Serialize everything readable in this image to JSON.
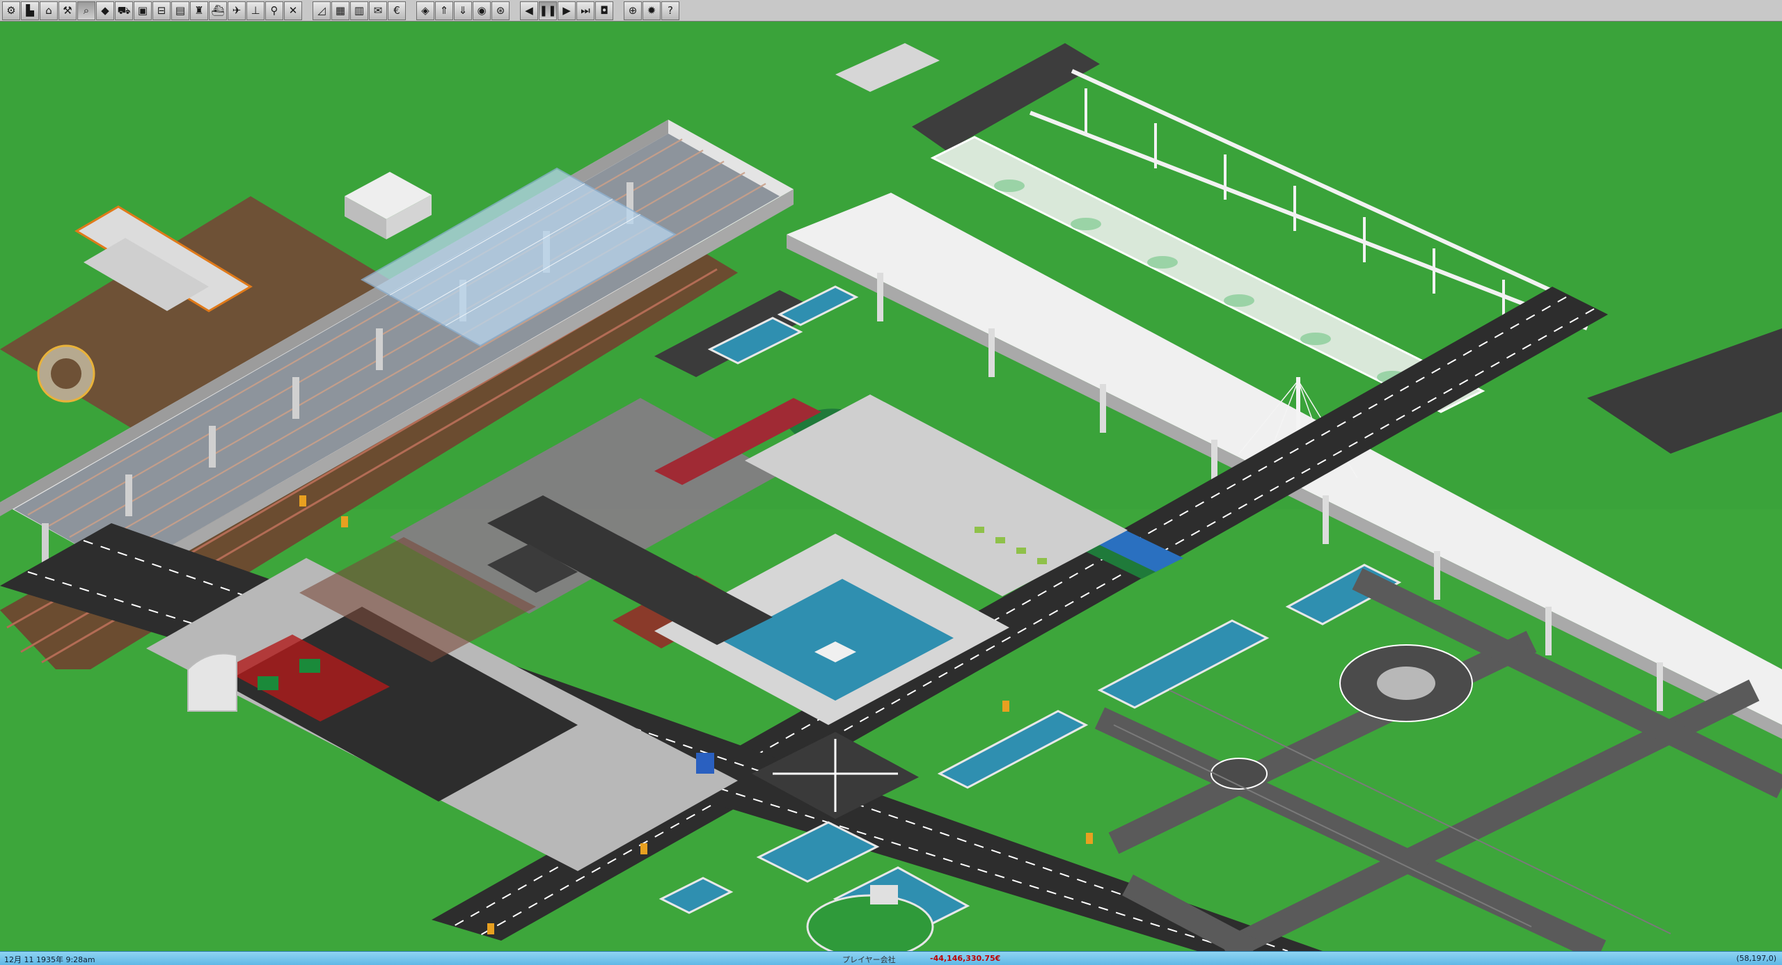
{
  "toolbar": {
    "groups": [
      [
        {
          "name": "settings-icon",
          "glyph": "⚙"
        },
        {
          "name": "factory-icon",
          "glyph": "▙"
        },
        {
          "name": "depot-icon",
          "glyph": "⌂"
        },
        {
          "name": "hammer-icon",
          "glyph": "⚒"
        },
        {
          "name": "magnifier-icon",
          "glyph": "⌕",
          "active": true
        },
        {
          "name": "terrain-icon",
          "glyph": "◆"
        },
        {
          "name": "road-vehicle-icon",
          "glyph": "⛟"
        },
        {
          "name": "bus-icon",
          "glyph": "▣"
        },
        {
          "name": "truck-icon",
          "glyph": "⊟"
        },
        {
          "name": "train-icon",
          "glyph": "▤"
        },
        {
          "name": "tram-icon",
          "glyph": "♜"
        },
        {
          "name": "ship-icon",
          "glyph": "⛴"
        },
        {
          "name": "airplane-icon",
          "glyph": "✈"
        },
        {
          "name": "crane-icon",
          "glyph": "⊥"
        },
        {
          "name": "tools-icon",
          "glyph": "⚲"
        },
        {
          "name": "remove-icon",
          "glyph": "✕"
        }
      ],
      [
        {
          "name": "slope-icon",
          "glyph": "◿"
        },
        {
          "name": "list-icon",
          "glyph": "▦"
        },
        {
          "name": "finance-icon",
          "glyph": "▥"
        },
        {
          "name": "mail-icon",
          "glyph": "✉"
        },
        {
          "name": "euro-icon",
          "glyph": "€"
        }
      ],
      [
        {
          "name": "layer-icon",
          "glyph": "◈"
        },
        {
          "name": "layer-up-icon",
          "glyph": "⇑"
        },
        {
          "name": "layer-down-icon",
          "glyph": "⇓"
        },
        {
          "name": "screenshot-icon",
          "glyph": "◉"
        },
        {
          "name": "network-icon",
          "glyph": "⊛"
        }
      ],
      [
        {
          "name": "step-back-icon",
          "glyph": "◀"
        },
        {
          "name": "pause-icon",
          "glyph": "❚❚",
          "active": true
        },
        {
          "name": "play-icon",
          "glyph": "▶"
        },
        {
          "name": "fast-forward-icon",
          "glyph": "⏭"
        },
        {
          "name": "camera-icon",
          "glyph": "◘"
        }
      ],
      [
        {
          "name": "globe-icon",
          "glyph": "⊕"
        },
        {
          "name": "gear-icon",
          "glyph": "✹"
        },
        {
          "name": "help-icon",
          "glyph": "?"
        }
      ]
    ]
  },
  "status": {
    "date": "12月 11 1935年 9:28am",
    "player": "プレイヤー会社",
    "money": "-44,146,330.75€",
    "coordinates": "(58,197,0)"
  },
  "colors": {
    "grass": "#3aa33a",
    "asphalt": "#2d2d2d",
    "water": "#2f8fb0",
    "viaduct": "#d8d8d8",
    "dirt": "#7a5a3a",
    "track": "#8a9098",
    "toolbar": "#c8c8c8",
    "statusbar": "#6ec4ec"
  }
}
